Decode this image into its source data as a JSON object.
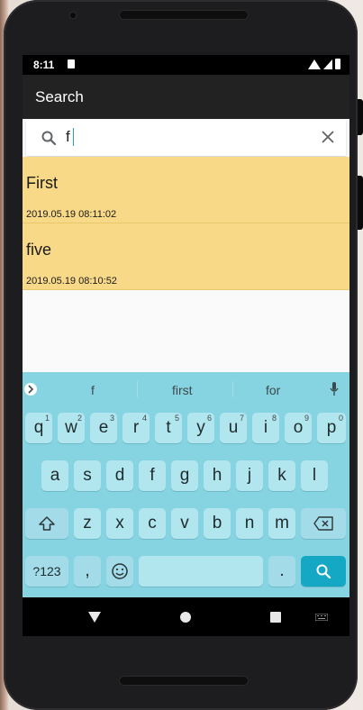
{
  "status_bar": {
    "time": "8:11"
  },
  "app_bar": {
    "title": "Search"
  },
  "search": {
    "value": "f",
    "placeholder": ""
  },
  "notes": [
    {
      "title": "First",
      "date": "2019.05.19 08:11:02"
    },
    {
      "title": "five",
      "date": "2019.05.19 08:10:52"
    }
  ],
  "keyboard": {
    "suggestions": [
      "f",
      "first",
      "for"
    ],
    "row1": [
      {
        "k": "q",
        "h": "1"
      },
      {
        "k": "w",
        "h": "2"
      },
      {
        "k": "e",
        "h": "3"
      },
      {
        "k": "r",
        "h": "4"
      },
      {
        "k": "t",
        "h": "5"
      },
      {
        "k": "y",
        "h": "6"
      },
      {
        "k": "u",
        "h": "7"
      },
      {
        "k": "i",
        "h": "8"
      },
      {
        "k": "o",
        "h": "9"
      },
      {
        "k": "p",
        "h": "0"
      }
    ],
    "row2": [
      "a",
      "s",
      "d",
      "f",
      "g",
      "h",
      "j",
      "k",
      "l"
    ],
    "row3": [
      "z",
      "x",
      "c",
      "v",
      "b",
      "n",
      "m"
    ],
    "symbols_label": "?123",
    "comma_label": ",",
    "period_label": "."
  },
  "colors": {
    "note_bg": "#f8d988",
    "appbar": "#222222",
    "keyboard_bg": "#86d3e2",
    "key_bg": "#b1e6ef",
    "search_key": "#15a8c4"
  }
}
